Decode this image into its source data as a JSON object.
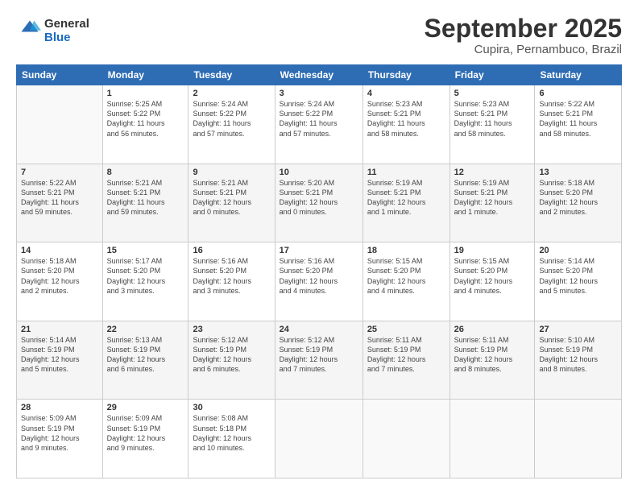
{
  "logo": {
    "line1": "General",
    "line2": "Blue"
  },
  "header": {
    "month": "September 2025",
    "location": "Cupira, Pernambuco, Brazil"
  },
  "weekdays": [
    "Sunday",
    "Monday",
    "Tuesday",
    "Wednesday",
    "Thursday",
    "Friday",
    "Saturday"
  ],
  "weeks": [
    [
      {
        "day": "",
        "info": ""
      },
      {
        "day": "1",
        "info": "Sunrise: 5:25 AM\nSunset: 5:22 PM\nDaylight: 11 hours\nand 56 minutes."
      },
      {
        "day": "2",
        "info": "Sunrise: 5:24 AM\nSunset: 5:22 PM\nDaylight: 11 hours\nand 57 minutes."
      },
      {
        "day": "3",
        "info": "Sunrise: 5:24 AM\nSunset: 5:22 PM\nDaylight: 11 hours\nand 57 minutes."
      },
      {
        "day": "4",
        "info": "Sunrise: 5:23 AM\nSunset: 5:21 PM\nDaylight: 11 hours\nand 58 minutes."
      },
      {
        "day": "5",
        "info": "Sunrise: 5:23 AM\nSunset: 5:21 PM\nDaylight: 11 hours\nand 58 minutes."
      },
      {
        "day": "6",
        "info": "Sunrise: 5:22 AM\nSunset: 5:21 PM\nDaylight: 11 hours\nand 58 minutes."
      }
    ],
    [
      {
        "day": "7",
        "info": "Sunrise: 5:22 AM\nSunset: 5:21 PM\nDaylight: 11 hours\nand 59 minutes."
      },
      {
        "day": "8",
        "info": "Sunrise: 5:21 AM\nSunset: 5:21 PM\nDaylight: 11 hours\nand 59 minutes."
      },
      {
        "day": "9",
        "info": "Sunrise: 5:21 AM\nSunset: 5:21 PM\nDaylight: 12 hours\nand 0 minutes."
      },
      {
        "day": "10",
        "info": "Sunrise: 5:20 AM\nSunset: 5:21 PM\nDaylight: 12 hours\nand 0 minutes."
      },
      {
        "day": "11",
        "info": "Sunrise: 5:19 AM\nSunset: 5:21 PM\nDaylight: 12 hours\nand 1 minute."
      },
      {
        "day": "12",
        "info": "Sunrise: 5:19 AM\nSunset: 5:21 PM\nDaylight: 12 hours\nand 1 minute."
      },
      {
        "day": "13",
        "info": "Sunrise: 5:18 AM\nSunset: 5:20 PM\nDaylight: 12 hours\nand 2 minutes."
      }
    ],
    [
      {
        "day": "14",
        "info": "Sunrise: 5:18 AM\nSunset: 5:20 PM\nDaylight: 12 hours\nand 2 minutes."
      },
      {
        "day": "15",
        "info": "Sunrise: 5:17 AM\nSunset: 5:20 PM\nDaylight: 12 hours\nand 3 minutes."
      },
      {
        "day": "16",
        "info": "Sunrise: 5:16 AM\nSunset: 5:20 PM\nDaylight: 12 hours\nand 3 minutes."
      },
      {
        "day": "17",
        "info": "Sunrise: 5:16 AM\nSunset: 5:20 PM\nDaylight: 12 hours\nand 4 minutes."
      },
      {
        "day": "18",
        "info": "Sunrise: 5:15 AM\nSunset: 5:20 PM\nDaylight: 12 hours\nand 4 minutes."
      },
      {
        "day": "19",
        "info": "Sunrise: 5:15 AM\nSunset: 5:20 PM\nDaylight: 12 hours\nand 4 minutes."
      },
      {
        "day": "20",
        "info": "Sunrise: 5:14 AM\nSunset: 5:20 PM\nDaylight: 12 hours\nand 5 minutes."
      }
    ],
    [
      {
        "day": "21",
        "info": "Sunrise: 5:14 AM\nSunset: 5:19 PM\nDaylight: 12 hours\nand 5 minutes."
      },
      {
        "day": "22",
        "info": "Sunrise: 5:13 AM\nSunset: 5:19 PM\nDaylight: 12 hours\nand 6 minutes."
      },
      {
        "day": "23",
        "info": "Sunrise: 5:12 AM\nSunset: 5:19 PM\nDaylight: 12 hours\nand 6 minutes."
      },
      {
        "day": "24",
        "info": "Sunrise: 5:12 AM\nSunset: 5:19 PM\nDaylight: 12 hours\nand 7 minutes."
      },
      {
        "day": "25",
        "info": "Sunrise: 5:11 AM\nSunset: 5:19 PM\nDaylight: 12 hours\nand 7 minutes."
      },
      {
        "day": "26",
        "info": "Sunrise: 5:11 AM\nSunset: 5:19 PM\nDaylight: 12 hours\nand 8 minutes."
      },
      {
        "day": "27",
        "info": "Sunrise: 5:10 AM\nSunset: 5:19 PM\nDaylight: 12 hours\nand 8 minutes."
      }
    ],
    [
      {
        "day": "28",
        "info": "Sunrise: 5:09 AM\nSunset: 5:19 PM\nDaylight: 12 hours\nand 9 minutes."
      },
      {
        "day": "29",
        "info": "Sunrise: 5:09 AM\nSunset: 5:19 PM\nDaylight: 12 hours\nand 9 minutes."
      },
      {
        "day": "30",
        "info": "Sunrise: 5:08 AM\nSunset: 5:18 PM\nDaylight: 12 hours\nand 10 minutes."
      },
      {
        "day": "",
        "info": ""
      },
      {
        "day": "",
        "info": ""
      },
      {
        "day": "",
        "info": ""
      },
      {
        "day": "",
        "info": ""
      }
    ]
  ]
}
